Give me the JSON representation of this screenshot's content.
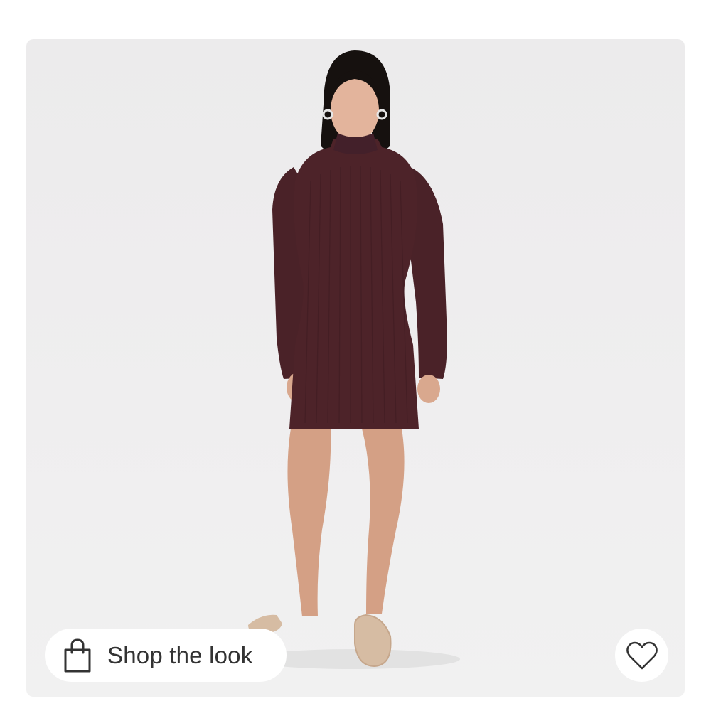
{
  "product_image": {
    "alt": "",
    "background_color": "#eeedee",
    "dress_color": "#4a2228",
    "skin_color": "#d9a88e",
    "shoe_color": "#d3b79d"
  },
  "shop_the_look": {
    "label": "Shop the look",
    "icon": "shopping-bag-icon"
  },
  "favorite": {
    "icon": "heart-outline-icon"
  }
}
